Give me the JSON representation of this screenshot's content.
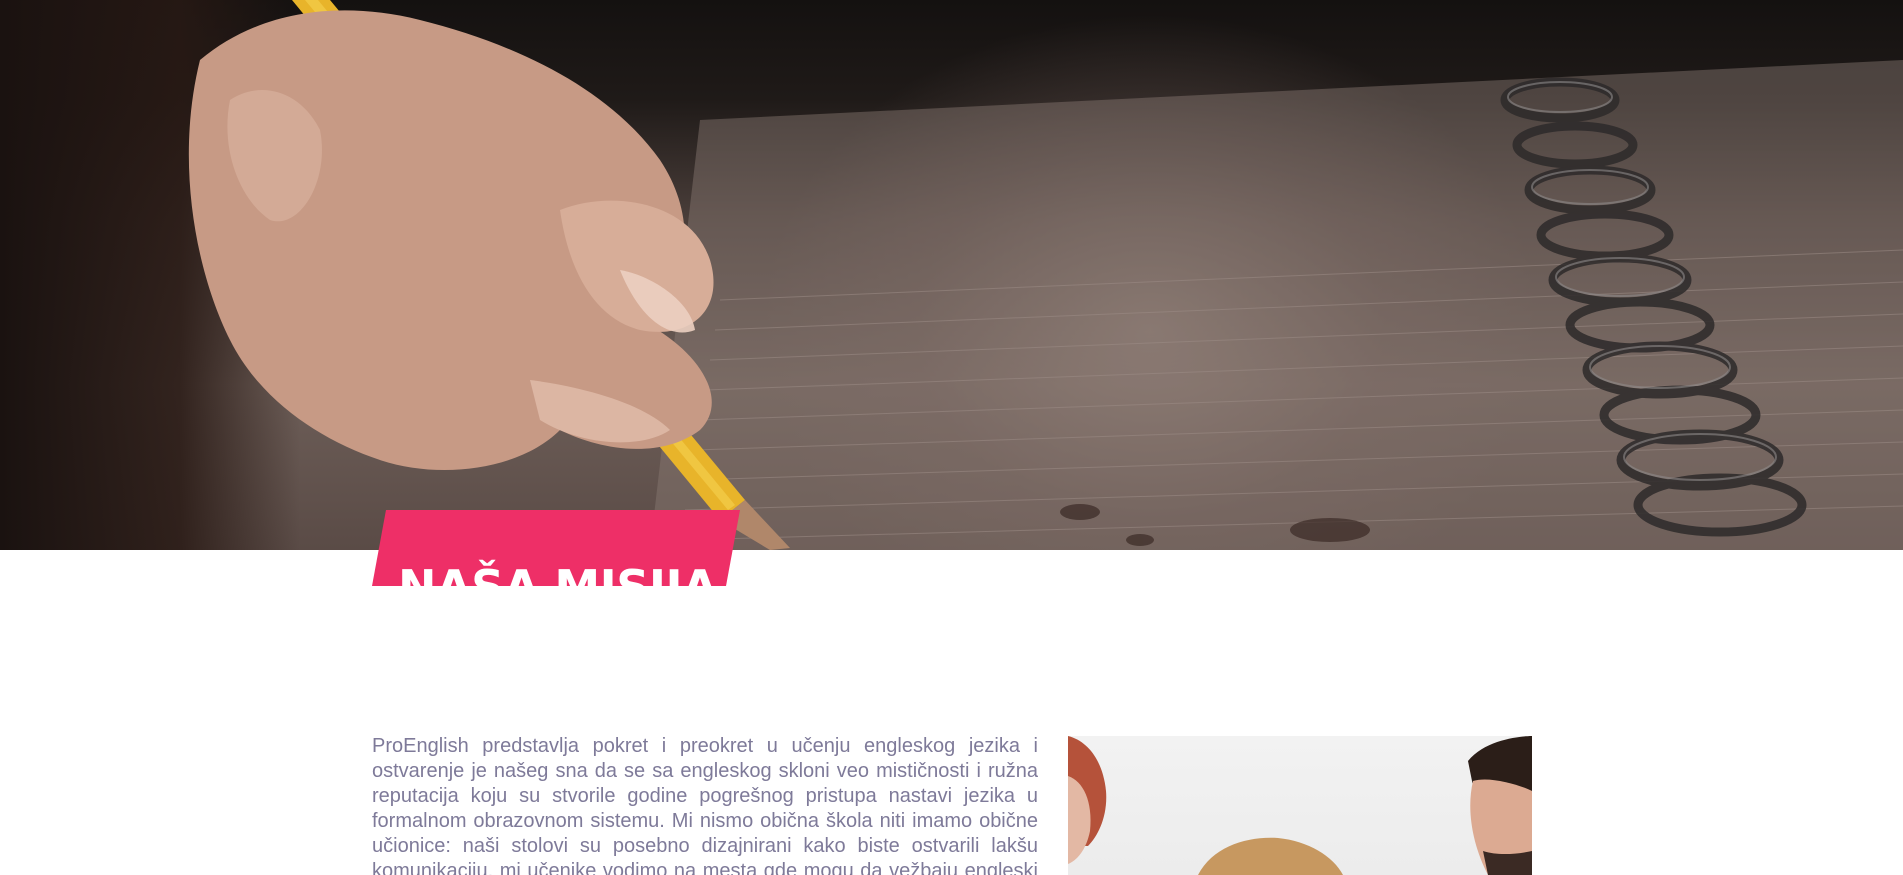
{
  "hero": {
    "image": "hand-writing-with-pencil-on-notebook"
  },
  "mission": {
    "title": "NAŠA MISIJA",
    "text": "ProEnglish predstavlja pokret i preokret u učenju engleskog jezika i ostvarenje je našeg sna da se sa engleskog skloni veo mističnosti i ružna reputacija koju su stvorile godine pogrešnog pristupa nastavi jezika u formalnom obrazovnom sistemu. Mi nismo obična škola niti imamo obične učionice: naši stolovi su posebno dizajnirani kako biste ostvarili lakšu komunikaciju, mi učenike vodimo na mesta gde mogu da vežbaju engleski u"
  },
  "photo": {
    "image": "students-in-classroom"
  },
  "colors": {
    "accent": "#ee2f67",
    "body_text": "#7e7a99",
    "background": "#ffffff"
  }
}
